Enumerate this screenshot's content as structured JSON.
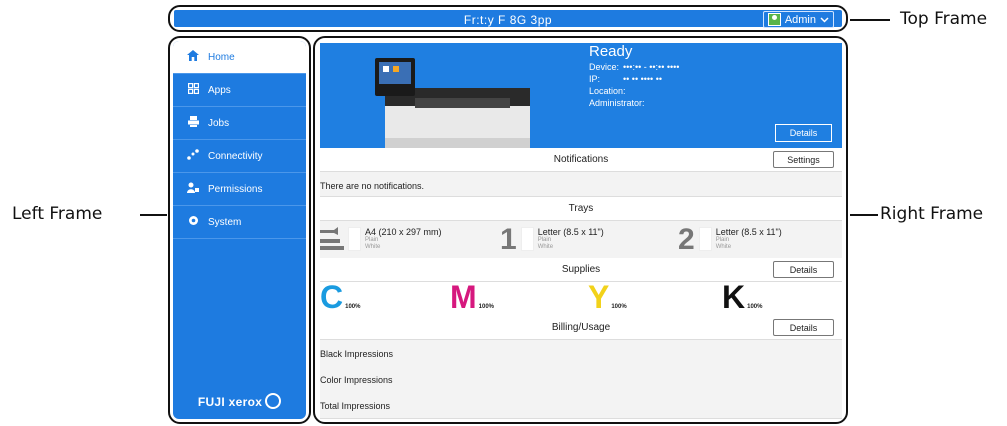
{
  "callouts": {
    "top": "Top Frame",
    "left": "Left Frame",
    "right": "Right Frame"
  },
  "topbar": {
    "title": "Fr:t:y F 8G 3pp",
    "admin_label": "Admin",
    "admin_chevron": "chevron-down-icon"
  },
  "sidebar": {
    "items": [
      {
        "label": "Home",
        "icon": "home-icon",
        "active": true
      },
      {
        "label": "Apps",
        "icon": "apps-icon",
        "active": false
      },
      {
        "label": "Jobs",
        "icon": "jobs-icon",
        "active": false
      },
      {
        "label": "Connectivity",
        "icon": "connectivity-icon",
        "active": false
      },
      {
        "label": "Permissions",
        "icon": "permissions-icon",
        "active": false
      },
      {
        "label": "System",
        "icon": "gear-icon",
        "active": false
      }
    ],
    "logo": "FUJI xerox"
  },
  "device": {
    "status": "Ready",
    "device_label": "Device:",
    "device_value": "•••:•• - ••:•• ••••",
    "ip_label": "IP:",
    "ip_value": "•• •• •••• ••",
    "location_label": "Location:",
    "administrator_label": "Administrator:",
    "details_label": "Details"
  },
  "notifications": {
    "title": "Notifications",
    "settings_label": "Settings",
    "message": "There are no notifications."
  },
  "trays": {
    "title": "Trays",
    "items": [
      {
        "num": "⇉",
        "name": "A4 (210 x 297 mm)",
        "type": "Plain",
        "color": "White"
      },
      {
        "num": "1",
        "name": "Letter (8.5 x 11\")",
        "type": "Plain",
        "color": "White"
      },
      {
        "num": "2",
        "name": "Letter (8.5 x 11\")",
        "type": "Plain",
        "color": "White"
      }
    ]
  },
  "supplies": {
    "title": "Supplies",
    "details_label": "Details",
    "items": [
      {
        "letter": "C",
        "pct": "100%",
        "color": "#1a9be0"
      },
      {
        "letter": "M",
        "pct": "100%",
        "color": "#d6187e"
      },
      {
        "letter": "Y",
        "pct": "100%",
        "color": "#f2d21a"
      },
      {
        "letter": "K",
        "pct": "100%",
        "color": "#111111"
      }
    ]
  },
  "billing": {
    "title": "Billing/Usage",
    "details_label": "Details",
    "rows": [
      "Black Impressions",
      "Color Impressions",
      "Total Impressions"
    ]
  },
  "colors": {
    "brand_blue": "#1e7be0"
  }
}
